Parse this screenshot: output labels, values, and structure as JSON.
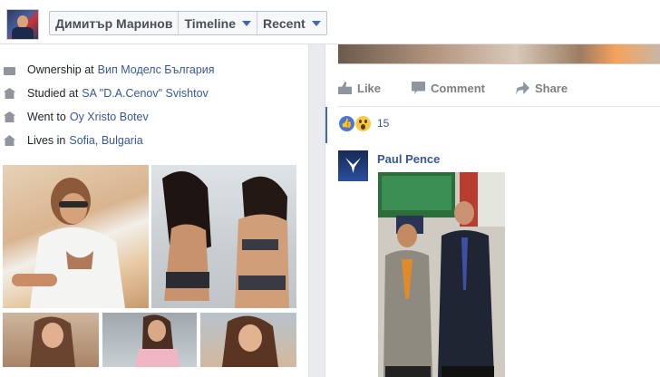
{
  "header": {
    "profile_name": "Димитър Маринов",
    "timeline_label": "Timeline",
    "recent_label": "Recent"
  },
  "intro": [
    {
      "prefix": "Ownership at",
      "link": "Вип Моделс България",
      "icon": "briefcase-icon"
    },
    {
      "prefix": "Studied at",
      "link": "SA \"D.A.Cenov\" Svishtov",
      "icon": "graduation-cap-icon"
    },
    {
      "prefix": "Went to",
      "link": "Оу Xristo Botev",
      "icon": "graduation-cap-icon"
    },
    {
      "prefix": "Lives in",
      "link": "Sofia, Bulgaria",
      "icon": "home-icon"
    }
  ],
  "post": {
    "actions": {
      "like": "Like",
      "comment": "Comment",
      "share": "Share"
    },
    "reaction_count": "15",
    "reactions": [
      "like",
      "wow"
    ],
    "comment_author": "Paul Pence"
  },
  "colors": {
    "link": "#365899",
    "background": "#e9ebee",
    "accent": "#4267b2"
  }
}
